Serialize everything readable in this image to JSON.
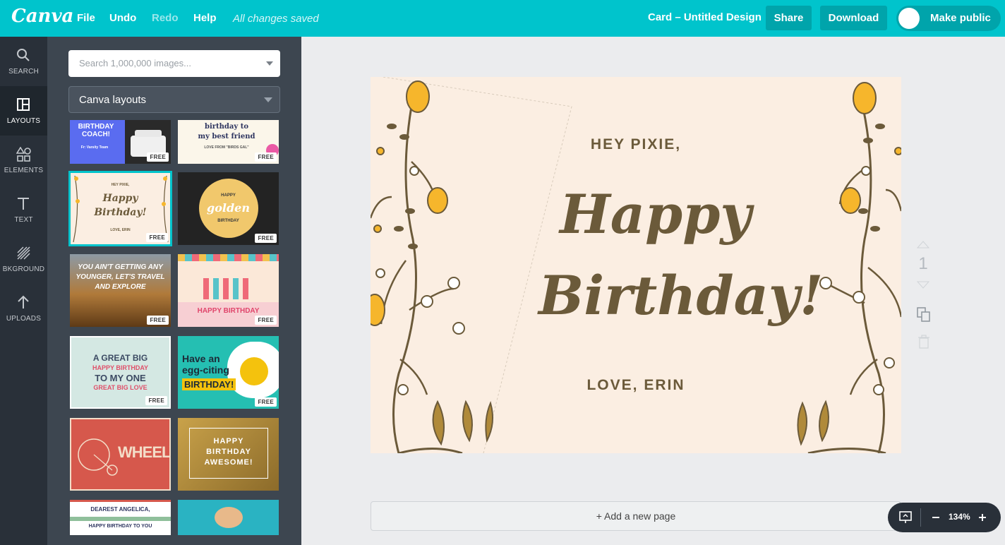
{
  "topbar": {
    "logo": "Canva",
    "menu": {
      "file": "File",
      "undo": "Undo",
      "redo": "Redo",
      "help": "Help"
    },
    "status": "All changes saved",
    "doc_title": "Card – Untitled Design",
    "share": "Share",
    "download": "Download",
    "make_public": "Make public"
  },
  "rail": {
    "search": "SEARCH",
    "layouts": "LAYOUTS",
    "elements": "ELEMENTS",
    "text": "TEXT",
    "background": "BKGROUND",
    "uploads": "UPLOADS"
  },
  "panel": {
    "search_placeholder": "Search 1,000,000 images...",
    "category": "Canva layouts",
    "free_badge": "FREE",
    "thumbs": {
      "t1": "BIRTHDAY COACH!",
      "t1b": "Fr: Varsity Team",
      "t2a": "birthday to",
      "t2b": "my best friend",
      "t2c": "LOVE FROM \"BIRDS GAL\"",
      "t3a": "HEY PIXIE,",
      "t3b": "Happy",
      "t3c": "Birthday!",
      "t3d": "LOVE, ERIN",
      "t4a": "HAPPY",
      "t4b": "golden",
      "t4c": "BIRTHDAY",
      "t5": "YOU AIN'T GETTING ANY YOUNGER, LET'S TRAVEL AND EXPLORE",
      "t6": "HAPPY BIRTHDAY",
      "t7a": "A GREAT BIG",
      "t7b": "HAPPY BIRTHDAY",
      "t7c": "TO MY ONE",
      "t7d": "GREAT BIG LOVE",
      "t8a": "Have an",
      "t8b": "egg-citing",
      "t8c": "BIRTHDAY!",
      "t9": "WHEELY",
      "t10": "HAPPY BIRTHDAY AWESOME!",
      "t11a": "DEAREST ANGELICA,",
      "t11b": "HAPPY BIRTHDAY TO YOU"
    }
  },
  "card": {
    "greeting": "HEY PIXIE,",
    "line1": "Happy",
    "line2": "Birthday!",
    "signoff": "LOVE, ERIN"
  },
  "page_number": "1",
  "add_page": "+ Add a new page",
  "zoom": "134%",
  "colors": {
    "accent": "#00c4cc",
    "rail": "#293039",
    "panel": "#3d4650",
    "card_bg": "#fbeee2",
    "card_text": "#6b5a3a",
    "flower_yellow": "#f6b62c"
  }
}
